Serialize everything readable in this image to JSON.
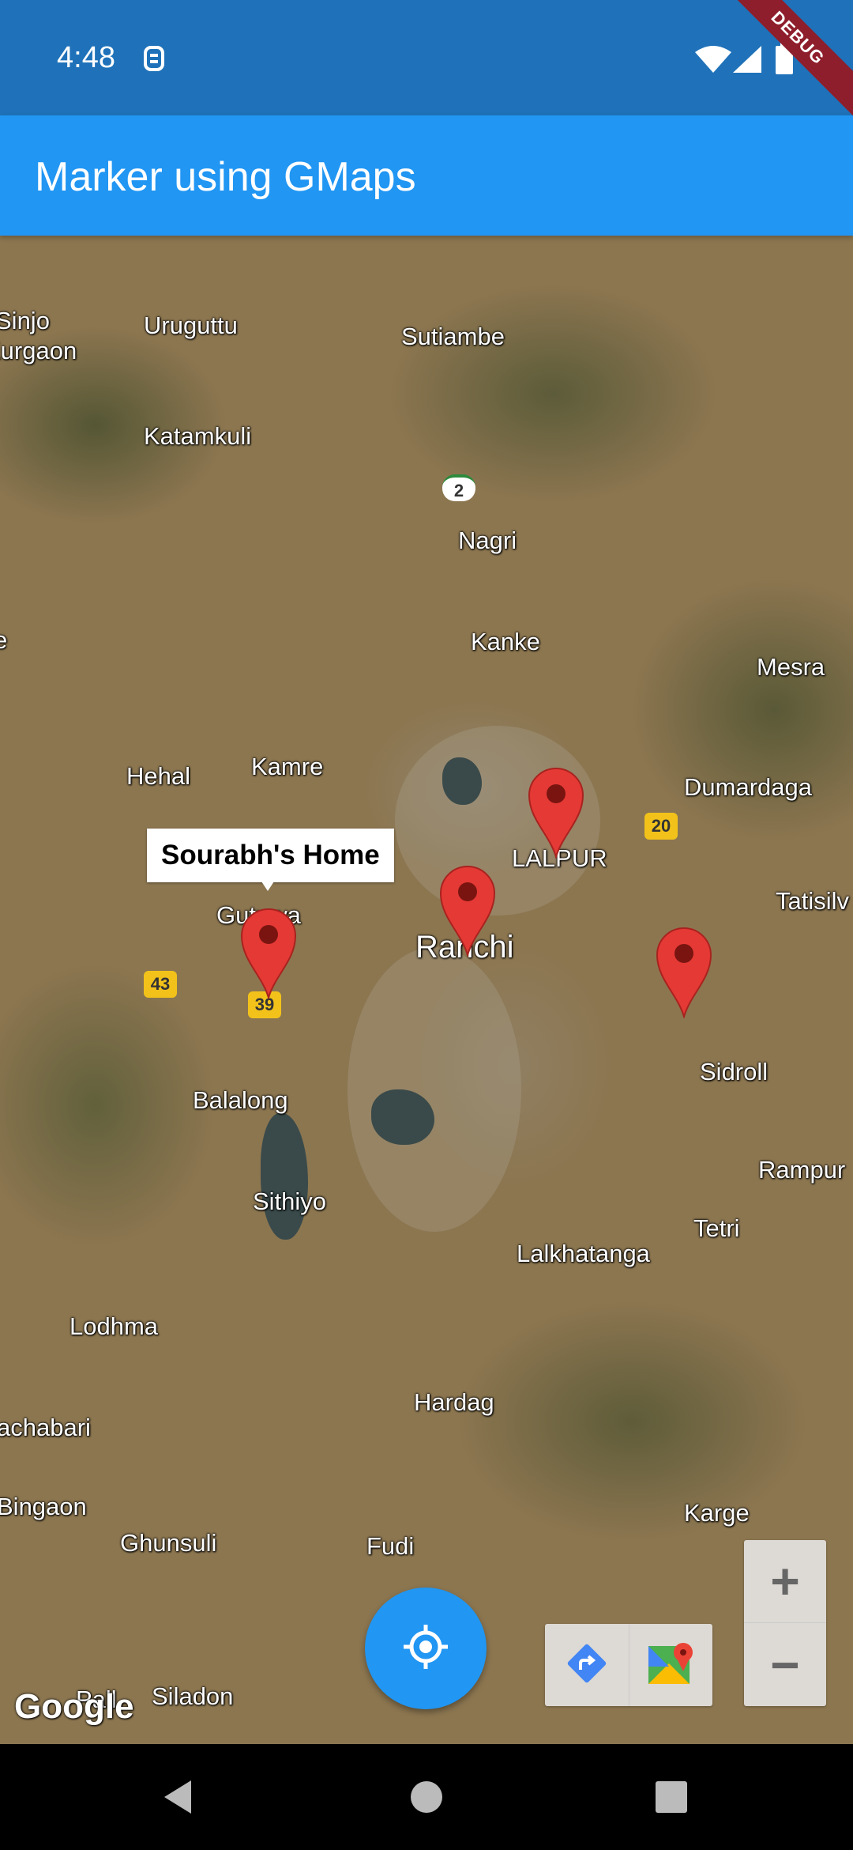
{
  "status_bar": {
    "time": "4:48",
    "debug_label": "DEBUG"
  },
  "app_bar": {
    "title": "Marker using GMaps"
  },
  "map": {
    "places": [
      {
        "name": "Sinjo"
      },
      {
        "name": "Kurgaon"
      },
      {
        "name": "Uruguttu"
      },
      {
        "name": "Sutiambe"
      },
      {
        "name": "Katamkuli"
      },
      {
        "name": "Nagri"
      },
      {
        "name": "Kanke"
      },
      {
        "name": "Mesra"
      },
      {
        "name": "Hehal"
      },
      {
        "name": "Kamre"
      },
      {
        "name": "Dumardaga"
      },
      {
        "name": "LALPUR"
      },
      {
        "name": "Tatisilv"
      },
      {
        "name": "Gutuwa"
      },
      {
        "name": "Ranchi"
      },
      {
        "name": "Sidroll"
      },
      {
        "name": "Balalong"
      },
      {
        "name": "Rampur"
      },
      {
        "name": "Sithiyo"
      },
      {
        "name": "Tetri"
      },
      {
        "name": "Lalkhatanga"
      },
      {
        "name": "Lodhma"
      },
      {
        "name": "Hardag"
      },
      {
        "name": "achabari"
      },
      {
        "name": "Bingaon"
      },
      {
        "name": "Ghunsuli"
      },
      {
        "name": "Fudi"
      },
      {
        "name": "Karge"
      },
      {
        "name": "Siladon"
      },
      {
        "name": "e"
      },
      {
        "name": "Pall"
      }
    ],
    "road_shields": [
      "2",
      "20",
      "43",
      "39"
    ],
    "info_window": "Sourabh's Home",
    "attribution": "Google",
    "zoom_in": "+",
    "zoom_out": "−"
  },
  "icons": {
    "fab": "my-location-icon",
    "directions": "directions-icon",
    "open_maps": "google-maps-icon"
  },
  "colors": {
    "app_bar": "#2196f3",
    "status_bar": "#1f72b9",
    "marker": "#e53935"
  }
}
